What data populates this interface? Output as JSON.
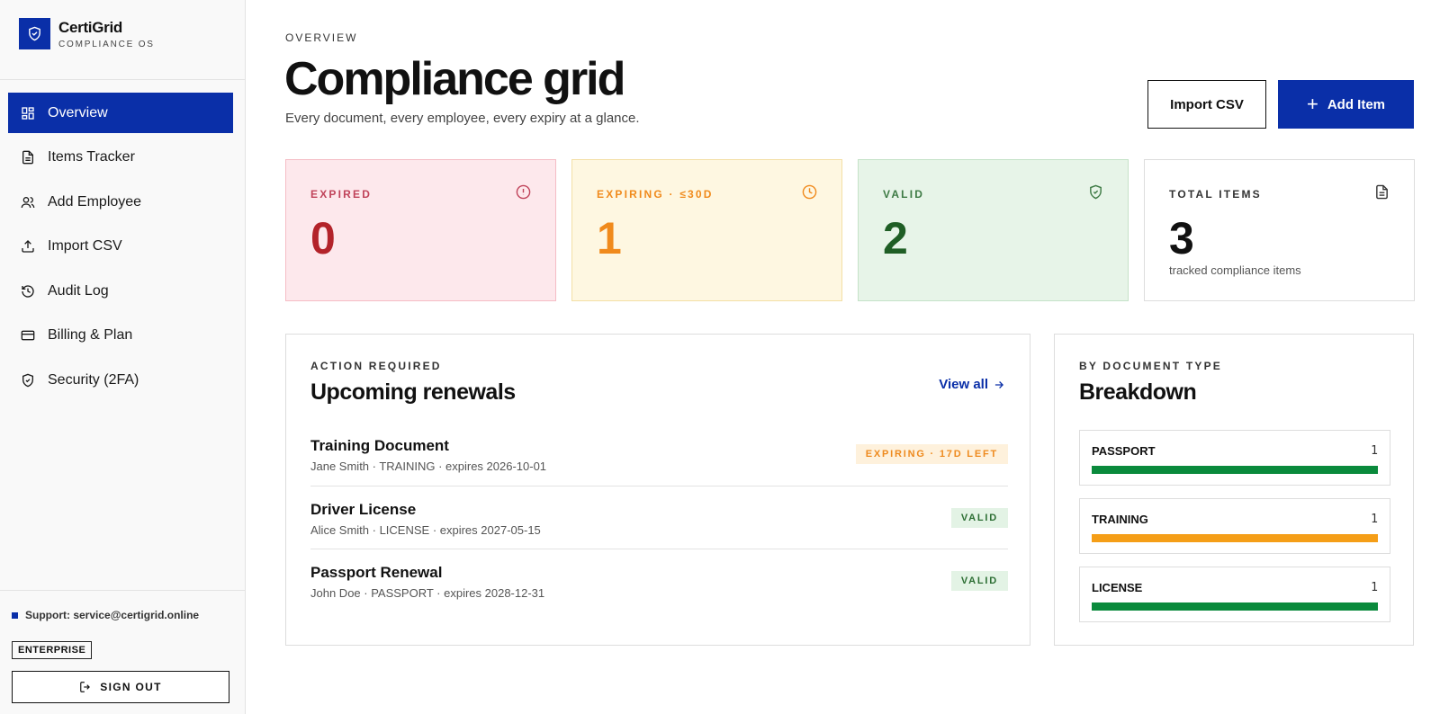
{
  "brand": {
    "name": "CertiGrid",
    "subtitle": "COMPLIANCE OS",
    "color": "#0a2fa8"
  },
  "sidebar": {
    "items": [
      {
        "label": "Overview",
        "icon": "grid-icon",
        "active": true
      },
      {
        "label": "Items Tracker",
        "icon": "file-list-icon",
        "active": false
      },
      {
        "label": "Add Employee",
        "icon": "users-icon",
        "active": false
      },
      {
        "label": "Import CSV",
        "icon": "upload-icon",
        "active": false
      },
      {
        "label": "Audit Log",
        "icon": "history-icon",
        "active": false
      },
      {
        "label": "Billing & Plan",
        "icon": "credit-card-icon",
        "active": false
      },
      {
        "label": "Security (2FA)",
        "icon": "shield-icon",
        "active": false
      }
    ],
    "support": "Support: service@certigrid.online",
    "plan": "ENTERPRISE",
    "signout": "SIGN OUT"
  },
  "header": {
    "eyebrow": "OVERVIEW",
    "title": "Compliance grid",
    "subtitle": "Every document, every employee, every expiry at a glance.",
    "import_label": "Import CSV",
    "add_label": "Add Item"
  },
  "stats": {
    "expired": {
      "label": "EXPIRED",
      "value": "0",
      "icon": "alert-circle-icon"
    },
    "expiring": {
      "label": "EXPIRING · ≤30D",
      "value": "1",
      "icon": "clock-icon"
    },
    "valid": {
      "label": "VALID",
      "value": "2",
      "icon": "shield-check-icon"
    },
    "total": {
      "label": "TOTAL ITEMS",
      "value": "3",
      "note": "tracked compliance items",
      "icon": "document-icon"
    }
  },
  "renewals": {
    "eyebrow": "ACTION REQUIRED",
    "title": "Upcoming renewals",
    "view_all": "View all",
    "rows": [
      {
        "title": "Training Document",
        "meta": "Jane Smith · TRAINING · expires 2026-10-01",
        "badge": "EXPIRING · 17D LEFT",
        "status": "expiring"
      },
      {
        "title": "Driver License",
        "meta": "Alice Smith · LICENSE · expires 2027-05-15",
        "badge": "VALID",
        "status": "valid"
      },
      {
        "title": "Passport Renewal",
        "meta": "John Doe · PASSPORT · expires 2028-12-31",
        "badge": "VALID",
        "status": "valid"
      }
    ]
  },
  "breakdown": {
    "eyebrow": "BY DOCUMENT TYPE",
    "title": "Breakdown",
    "items": [
      {
        "name": "PASSPORT",
        "count": "1",
        "fill": 1.0,
        "color": "#0a8a3c"
      },
      {
        "name": "TRAINING",
        "count": "1",
        "fill": 1.0,
        "color": "#f59e17"
      },
      {
        "name": "LICENSE",
        "count": "1",
        "fill": 1.0,
        "color": "#0a8a3c"
      }
    ]
  }
}
